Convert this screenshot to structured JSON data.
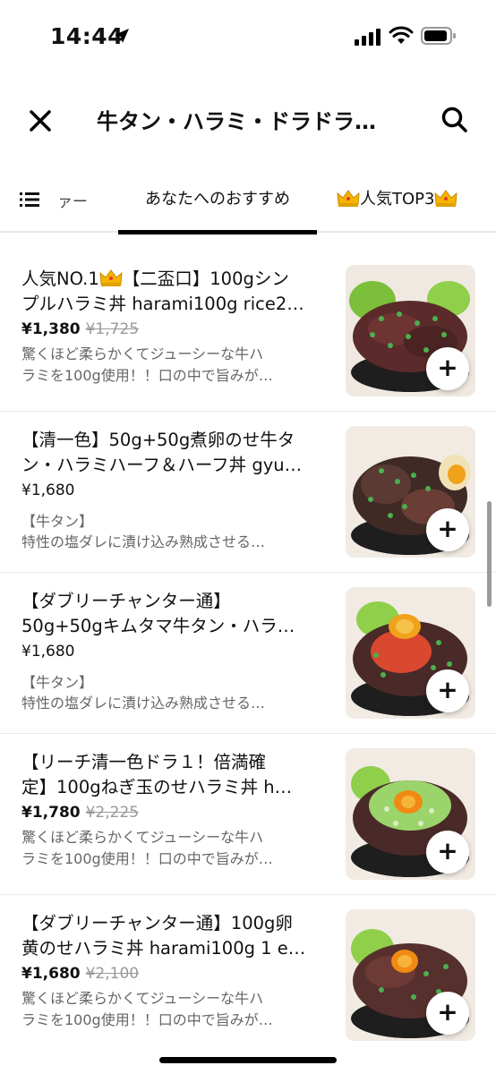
{
  "status_bar": {
    "time": "14:44"
  },
  "header": {
    "title": "牛タン・ハラミ・ドラドラ…"
  },
  "tabs": {
    "menu_label": "ァー",
    "recommended_label": "あなたへのおすすめ",
    "top3_label": "人気TOP3"
  },
  "items": [
    {
      "title_line1": "人気NO.1",
      "title_line1_rest": "【二盃口】100gシン",
      "title_line2": "プルハラミ丼 harami100g rice2…",
      "price": "¥1,380",
      "original_price": "¥1,725",
      "desc_line1": "驚くほど柔らかくてジューシーな牛ハ",
      "desc_line2": "ラミを100g使用！！口の中で旨みが…"
    },
    {
      "title_line1": "【清一色】50g+50g煮卵のせ牛タ",
      "title_line2": "ン・ハラミハーフ＆ハーフ丼 gyu…",
      "price": "¥1,680",
      "tag": "【牛タン】",
      "desc_line1": "特性の塩ダレに漬け込み熟成させる…"
    },
    {
      "title_line1": "【ダブリーチャンター通】",
      "title_line2": "50g+50gキムタマ牛タン・ハラ…",
      "price": "¥1,680",
      "tag": "【牛タン】",
      "desc_line1": "特性の塩ダレに漬け込み熟成させる…"
    },
    {
      "title_line1": "【リーチ清一色ドラ１！倍満確",
      "title_line2": "定】100gねぎ玉のせハラミ丼 h…",
      "price": "¥1,780",
      "original_price": "¥2,225",
      "desc_line1": "驚くほど柔らかくてジューシーな牛ハ",
      "desc_line2": "ラミを100g使用！！口の中で旨みが…"
    },
    {
      "title_line1": "【ダブリーチャンター通】100g卵",
      "title_line2": "黄のせハラミ丼 harami100g 1 e…",
      "price": "¥1,680",
      "original_price": "¥2,100",
      "desc_line1": "驚くほど柔らかくてジューシーな牛ハ",
      "desc_line2": "ラミを100g使用！！口の中で旨みが…"
    }
  ],
  "add_button_label": "+",
  "icons": {
    "close": "close-icon",
    "search": "search-icon",
    "menu_list": "list-icon",
    "crown": "crown-icon",
    "add": "plus-icon"
  }
}
